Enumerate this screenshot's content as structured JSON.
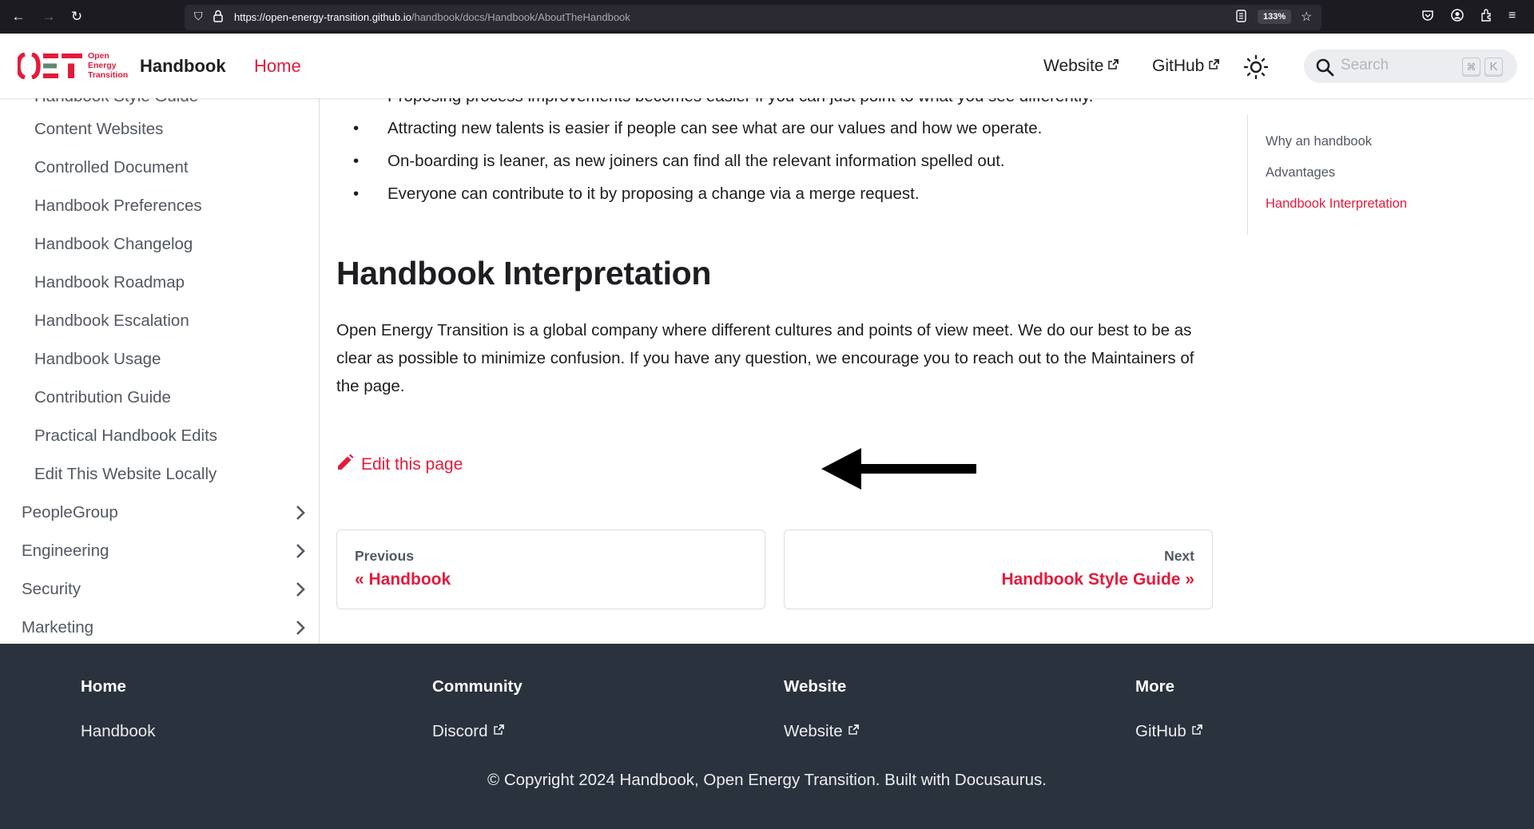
{
  "browser": {
    "url_host": "https://open-energy-transition.github.io",
    "url_path": "/handbook/docs/Handbook/AboutTheHandbook",
    "zoom_level": "133%"
  },
  "navbar": {
    "logo_mark": "OET",
    "logo_text": [
      "Open",
      "Energy",
      "Transition"
    ],
    "title": "Handbook",
    "home": "Home",
    "website": "Website",
    "github": "GitHub",
    "search_placeholder": "Search",
    "kbd_cmd": "⌘",
    "kbd_k": "K"
  },
  "sidebar": {
    "clipped_item": "Handbook Style Guide",
    "items": [
      "Content Websites",
      "Controlled Document",
      "Handbook Preferences",
      "Handbook Changelog",
      "Handbook Roadmap",
      "Handbook Escalation",
      "Handbook Usage",
      "Contribution Guide",
      "Practical Handbook Edits",
      "Edit This Website Locally"
    ],
    "categories": [
      "PeopleGroup",
      "Engineering",
      "Security",
      "Marketing"
    ]
  },
  "content": {
    "bullets": [
      "Proposing process improvements becomes easier if you can just point to what you see differently.",
      "Attracting new talents is easier if people can see what are our values and how we operate.",
      "On-boarding is leaner, as new joiners can find all the relevant information spelled out.",
      "Everyone can contribute to it by proposing a change via a merge request."
    ],
    "heading": "Handbook Interpretation",
    "paragraph": "Open Energy Transition is a global company where different cultures and points of view meet. We do our best to be as clear as possible to minimize confusion. If you have any question, we encourage you to reach out to the Maintainers of the page.",
    "edit_link": "Edit this page",
    "pager": {
      "prev_sub": "Previous",
      "prev_label": "« Handbook",
      "next_sub": "Next",
      "next_label": "Handbook Style Guide »"
    }
  },
  "toc": {
    "items": [
      "Why an handbook",
      "Advantages",
      "Handbook Interpretation"
    ],
    "active_index": 2
  },
  "footer": {
    "columns": [
      {
        "title": "Home",
        "link": "Handbook"
      },
      {
        "title": "Community",
        "link": "Discord"
      },
      {
        "title": "Website",
        "link": "Website"
      },
      {
        "title": "More",
        "link": "GitHub"
      }
    ],
    "copyright": "© Copyright 2024 Handbook, Open Energy Transition. Built with Docusaurus."
  },
  "colors": {
    "accent": "#e31b3b",
    "footer_bg": "#2a323d",
    "text": "#1c1e21",
    "sidebar_text": "#525860"
  }
}
